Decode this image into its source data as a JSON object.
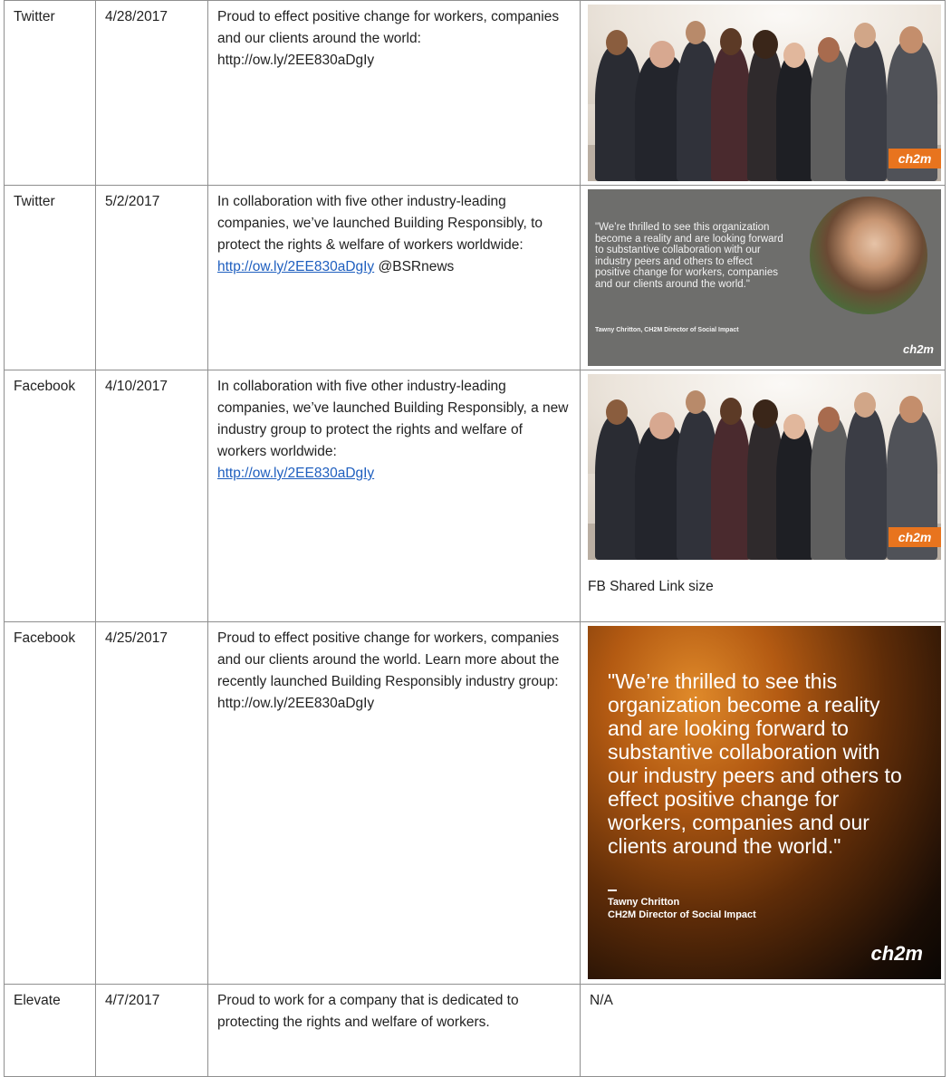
{
  "rows": [
    {
      "platform": "Twitter",
      "date": "4/28/2017",
      "text": "Proud to effect positive change for workers, companies and our clients around the world: http://ow.ly/2EE830aDgIy",
      "visual_type": "group-photo",
      "logo": "ch2m"
    },
    {
      "platform": "Twitter",
      "date": "5/2/2017",
      "text_before": "In collaboration with five other industry-leading companies, we’ve launched Building Responsibly, to protect the rights & welfare of workers worldwide:",
      "link": "http://ow.ly/2EE830aDgIy",
      "text_after": " @BSRnews",
      "visual_quote": "\"We’re thrilled to see this organization become a reality and are looking forward to substantive collaboration with our industry peers and others to effect positive change for workers, companies and our clients around the world.\"",
      "visual_attrib": "Tawny Chritton, CH2M Director of Social Impact",
      "logo": "ch2m"
    },
    {
      "platform": "Facebook",
      "date": "4/10/2017",
      "text_before": "In collaboration with five other industry-leading companies, we’ve launched Building Responsibly, a new industry group to protect the rights and welfare of workers worldwide:",
      "link": "http://ow.ly/2EE830aDgIy",
      "caption": "FB Shared Link size",
      "logo": "ch2m"
    },
    {
      "platform": "Facebook",
      "date": "4/25/2017",
      "text": "Proud to effect positive change for workers, companies and our clients around the world. Learn more about the recently launched Building Responsibly industry group: http://ow.ly/2EE830aDgIy",
      "visual_quote": "\"We’re thrilled to see this organization become a reality and are looking forward to substantive collaboration with our industry peers and others to effect positive change for workers, companies and our clients around the world.\"",
      "visual_name": "Tawny Chritton",
      "visual_title": "CH2M Director of Social Impact",
      "logo": "ch2m"
    },
    {
      "platform": "Elevate",
      "date": "4/7/2017",
      "text": "Proud to work for a company that is dedicated to protecting the rights and welfare of workers.",
      "visual_text": "N/A"
    }
  ],
  "colors": {
    "border": "#8f8f8f",
    "link": "#1f5fbf",
    "brand_orange": "#e8741e"
  }
}
